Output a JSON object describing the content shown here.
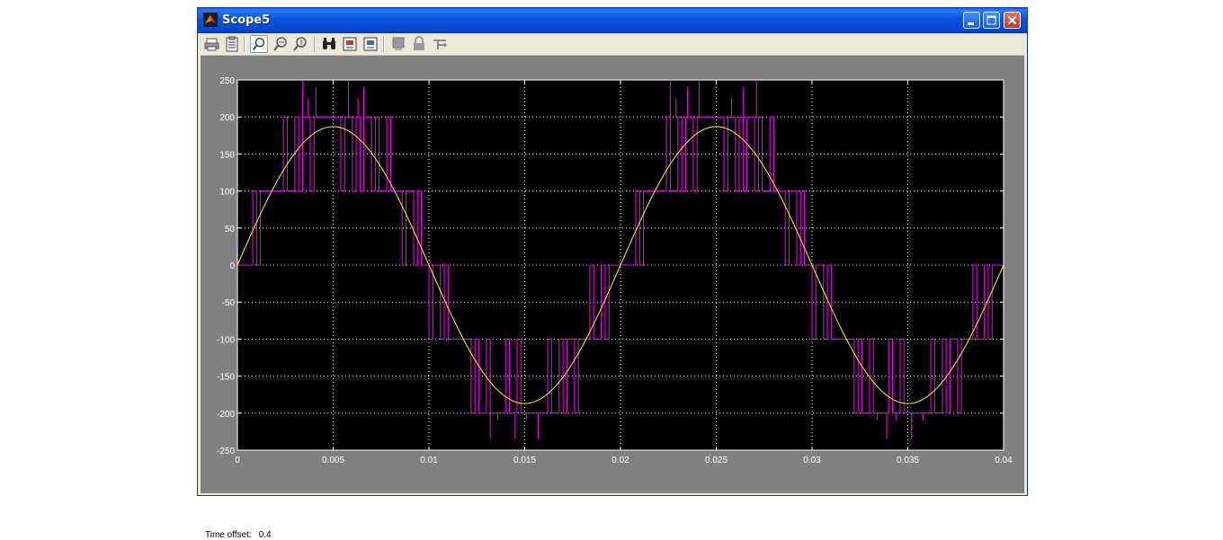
{
  "window": {
    "title": "Scope5"
  },
  "toolbar": {
    "tools": [
      "print-icon",
      "parameters-icon",
      "zoom-icon",
      "zoom-x-icon",
      "zoom-y-icon",
      "autoscale-icon",
      "save-axes-icon",
      "restore-axes-icon",
      "floating-scope-icon",
      "lock-axes-icon",
      "signal-selection-icon"
    ]
  },
  "status": {
    "label": "Time offset:",
    "value": "0.4"
  },
  "colors": {
    "plot_background": "#000000",
    "figure_background": "#808080",
    "grid": "#ffffff",
    "series_pwm": "#ff00ff",
    "series_sine": "#ffff00"
  },
  "chart_data": {
    "type": "line",
    "title": "",
    "xlabel": "",
    "ylabel": "",
    "xlim": [
      0,
      0.04
    ],
    "ylim": [
      -250,
      250
    ],
    "grid": true,
    "x_ticks": [
      0,
      0.005,
      0.01,
      0.015,
      0.02,
      0.025,
      0.03,
      0.035,
      0.04
    ],
    "x_tick_labels": [
      "0",
      "0.005",
      "0.01",
      "0.015",
      "0.02",
      "0.025",
      "0.03",
      "0.035",
      "0.04"
    ],
    "y_ticks": [
      250,
      200,
      150,
      100,
      50,
      0,
      -50,
      -100,
      -150,
      -200,
      -250
    ],
    "y_tick_labels": [
      "250",
      "200",
      "150",
      "100",
      "50",
      "0",
      "-50",
      "-100",
      "-150",
      "-200",
      "-250"
    ],
    "series": [
      {
        "color": "#ffff00",
        "description": "sine, amplitude 187, frequency 50 Hz",
        "amplitude": 187,
        "frequency_hz": 50
      },
      {
        "color": "#ff00ff",
        "description": "multilevel PWM switching between 0, ±100, ±200 with occasional spikes to ±250",
        "levels": [
          -200,
          -100,
          0,
          100,
          200
        ],
        "band_edges": [
          [
            0,
            0.0017
          ],
          [
            0.0017,
            0.0083
          ],
          [
            0.0083,
            0.01
          ],
          [
            0.01,
            0.0117
          ],
          [
            0.0117,
            0.0183
          ],
          [
            0.0183,
            0.02
          ],
          [
            0.02,
            0.0217
          ],
          [
            0.0217,
            0.0283
          ],
          [
            0.0283,
            0.03
          ],
          [
            0.03,
            0.0317
          ],
          [
            0.0317,
            0.0383
          ],
          [
            0.0383,
            0.04
          ]
        ],
        "spike_peaks": [
          250,
          220,
          -235,
          -250
        ]
      }
    ]
  }
}
